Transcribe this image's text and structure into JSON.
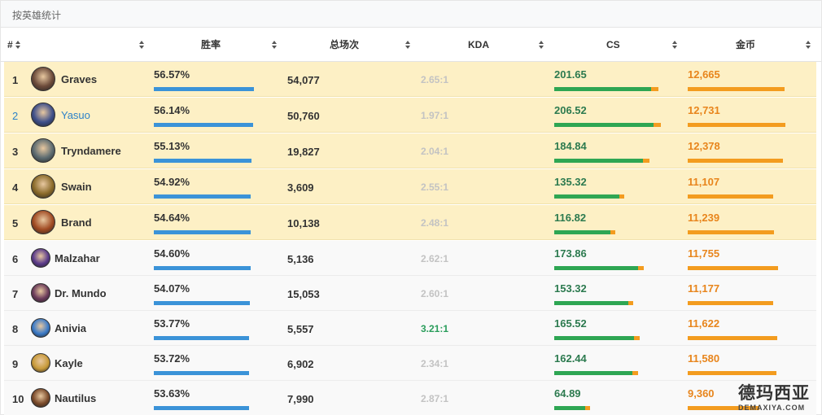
{
  "panel": {
    "title": "按英雄统计"
  },
  "columns": [
    {
      "key": "rank",
      "label": "#"
    },
    {
      "key": "hero",
      "label": ""
    },
    {
      "key": "winrate",
      "label": "胜率"
    },
    {
      "key": "games",
      "label": "总场次"
    },
    {
      "key": "kda",
      "label": "KDA"
    },
    {
      "key": "cs",
      "label": "CS"
    },
    {
      "key": "gold",
      "label": "金币"
    }
  ],
  "rows": [
    {
      "rank": "1",
      "name": "Graves",
      "winrate": "56.57%",
      "winrate_value": 56.57,
      "games": "54,077",
      "kda": "2.65:1",
      "cs": "201.65",
      "cs_value": 201.65,
      "gold": "12,665",
      "gold_value": 12665,
      "highlight": true,
      "link": false,
      "avatar_icon": "graves-avatar-icon",
      "avatar_color": "#6b4a3a"
    },
    {
      "rank": "2",
      "name": "Yasuo",
      "winrate": "56.14%",
      "winrate_value": 56.14,
      "games": "50,760",
      "kda": "1.97:1",
      "cs": "206.52",
      "cs_value": 206.52,
      "gold": "12,731",
      "gold_value": 12731,
      "highlight": true,
      "link": true,
      "avatar_icon": "yasuo-avatar-icon",
      "avatar_color": "#3e4f8a"
    },
    {
      "rank": "3",
      "name": "Tryndamere",
      "winrate": "55.13%",
      "winrate_value": 55.13,
      "games": "19,827",
      "kda": "2.04:1",
      "cs": "184.84",
      "cs_value": 184.84,
      "gold": "12,378",
      "gold_value": 12378,
      "highlight": true,
      "link": false,
      "avatar_icon": "tryndamere-avatar-icon",
      "avatar_color": "#5c6b70"
    },
    {
      "rank": "4",
      "name": "Swain",
      "winrate": "54.92%",
      "winrate_value": 54.92,
      "games": "3,609",
      "kda": "2.55:1",
      "cs": "135.32",
      "cs_value": 135.32,
      "gold": "11,107",
      "gold_value": 11107,
      "highlight": true,
      "link": false,
      "avatar_icon": "swain-avatar-icon",
      "avatar_color": "#8a6a2a"
    },
    {
      "rank": "5",
      "name": "Brand",
      "winrate": "54.64%",
      "winrate_value": 54.64,
      "games": "10,138",
      "kda": "2.48:1",
      "cs": "116.82",
      "cs_value": 116.82,
      "gold": "11,239",
      "gold_value": 11239,
      "highlight": true,
      "link": false,
      "avatar_icon": "brand-avatar-icon",
      "avatar_color": "#a04a22"
    },
    {
      "rank": "6",
      "name": "Malzahar",
      "winrate": "54.60%",
      "winrate_value": 54.6,
      "games": "5,136",
      "kda": "2.62:1",
      "cs": "173.86",
      "cs_value": 173.86,
      "gold": "11,755",
      "gold_value": 11755,
      "highlight": false,
      "link": false,
      "avatar_icon": "malzahar-avatar-icon",
      "avatar_color": "#5a3a8a"
    },
    {
      "rank": "7",
      "name": "Dr. Mundo",
      "winrate": "54.07%",
      "winrate_value": 54.07,
      "games": "15,053",
      "kda": "2.60:1",
      "cs": "153.32",
      "cs_value": 153.32,
      "gold": "11,177",
      "gold_value": 11177,
      "highlight": false,
      "link": false,
      "avatar_icon": "drmundo-avatar-icon",
      "avatar_color": "#6a3a5a"
    },
    {
      "rank": "8",
      "name": "Anivia",
      "winrate": "53.77%",
      "winrate_value": 53.77,
      "games": "5,557",
      "kda": "3.21:1",
      "cs": "165.52",
      "cs_value": 165.52,
      "gold": "11,622",
      "gold_value": 11622,
      "highlight": false,
      "link": false,
      "kda_good": true,
      "avatar_icon": "anivia-avatar-icon",
      "avatar_color": "#3a7ac8"
    },
    {
      "rank": "9",
      "name": "Kayle",
      "winrate": "53.72%",
      "winrate_value": 53.72,
      "games": "6,902",
      "kda": "2.34:1",
      "cs": "162.44",
      "cs_value": 162.44,
      "gold": "11,580",
      "gold_value": 11580,
      "highlight": false,
      "link": false,
      "avatar_icon": "kayle-avatar-icon",
      "avatar_color": "#c89a3a"
    },
    {
      "rank": "10",
      "name": "Nautilus",
      "winrate": "53.63%",
      "winrate_value": 53.63,
      "games": "7,990",
      "kda": "2.87:1",
      "cs": "64.89",
      "cs_value": 64.89,
      "gold": "9,360",
      "gold_value": 9360,
      "highlight": false,
      "link": false,
      "avatar_icon": "nautilus-avatar-icon",
      "avatar_color": "#7a4a2a"
    }
  ],
  "colors": {
    "highlight_row": "#fdf0c5",
    "winrate_bar": "#3b93d8",
    "cs_bar": "#2ea653",
    "gold_bar": "#f39c1f",
    "link": "#2d82c8"
  },
  "watermark": {
    "cn": "德玛西亚",
    "en": "DEMAXIYA.COM"
  }
}
